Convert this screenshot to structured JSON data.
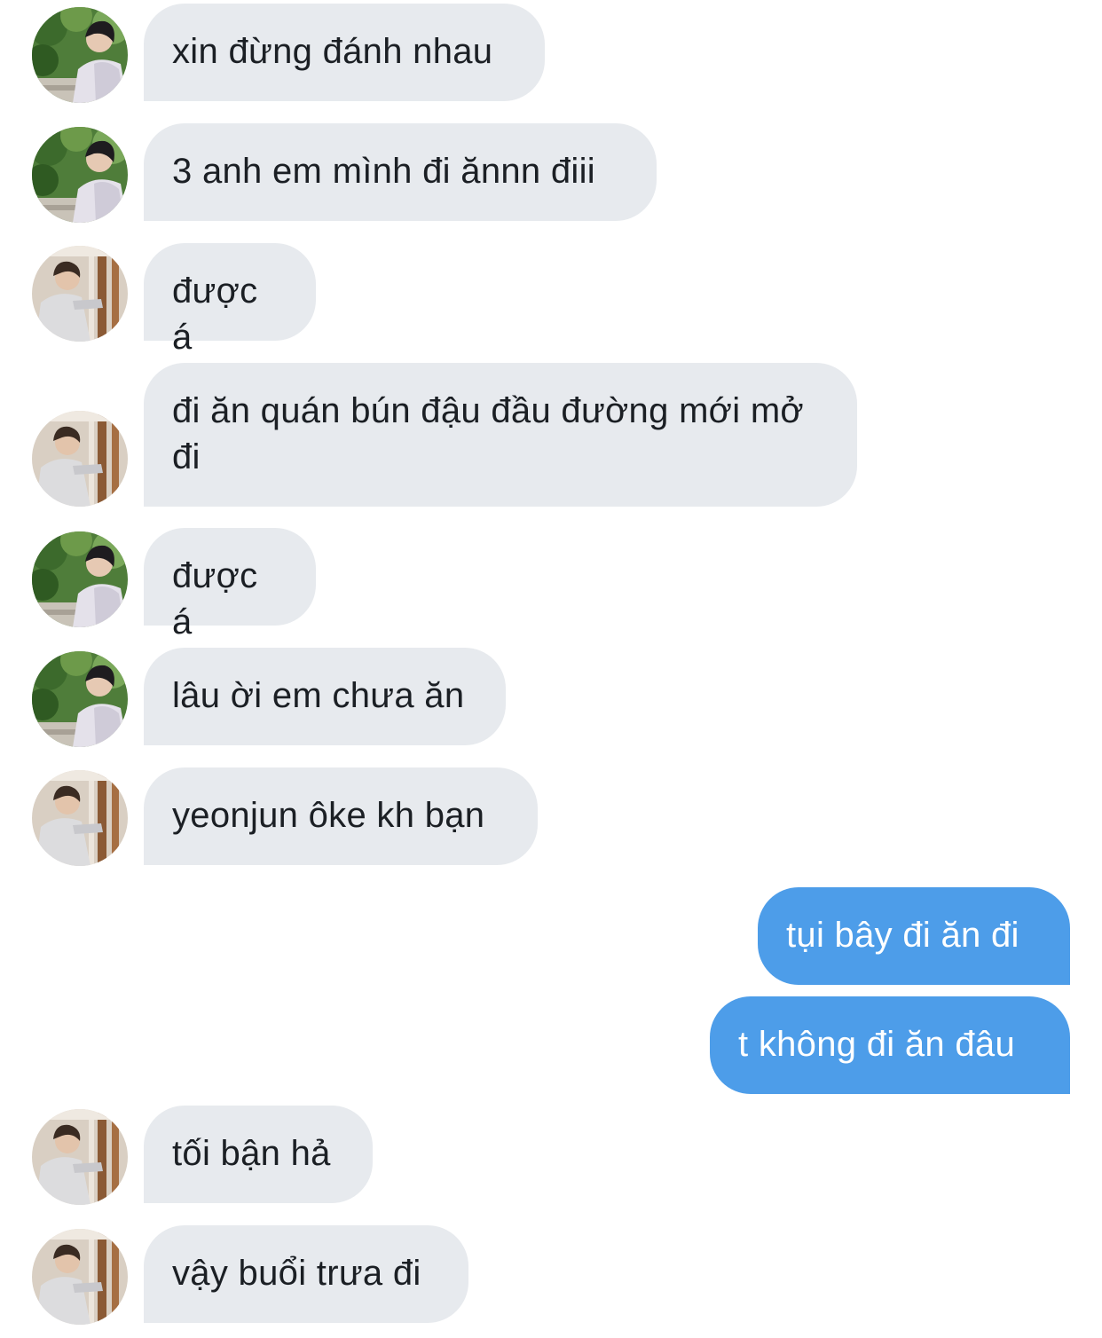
{
  "conversation": {
    "messages": [
      {
        "side": "in",
        "avatar": "outdoor-portrait",
        "text": "xin đừng đánh nhau"
      },
      {
        "side": "in",
        "avatar": "outdoor-portrait",
        "text": "3 anh em mình đi ănnn điii"
      },
      {
        "side": "in",
        "avatar": "indoor-portrait",
        "text": "được á"
      },
      {
        "side": "in",
        "avatar": "indoor-portrait",
        "text": "đi ăn quán bún đậu đầu đường mới mở đi"
      },
      {
        "side": "in",
        "avatar": "outdoor-portrait",
        "text": "được á"
      },
      {
        "side": "in",
        "avatar": "outdoor-portrait",
        "text": "lâu ời em chưa ăn"
      },
      {
        "side": "in",
        "avatar": "indoor-portrait",
        "text": "yeonjun ôke kh bạn"
      },
      {
        "side": "out",
        "text": "tụi bây đi ăn đi"
      },
      {
        "side": "out",
        "text": "t không đi ăn đâu"
      },
      {
        "side": "in",
        "avatar": "indoor-portrait",
        "text": "tối bận hả"
      },
      {
        "side": "in",
        "avatar": "indoor-portrait",
        "text": "vậy buổi trưa đi"
      }
    ]
  },
  "colors": {
    "incoming_bubble": "#e7eaee",
    "outgoing_bubble": "#4d9de9",
    "background": "#ffffff"
  }
}
